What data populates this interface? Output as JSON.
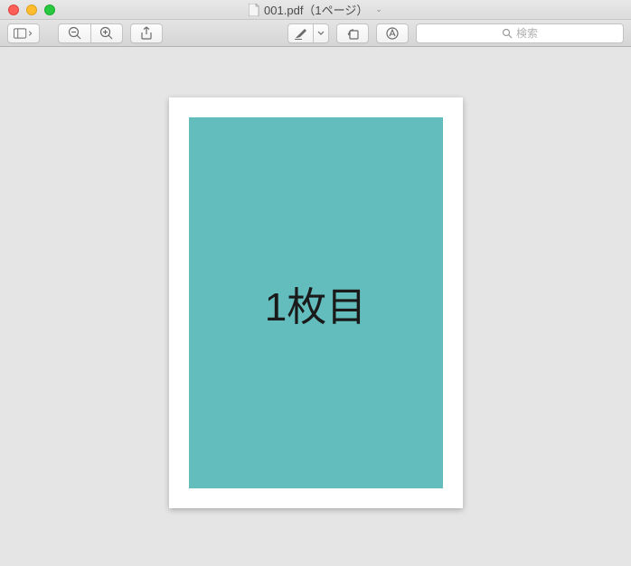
{
  "window": {
    "title": "001.pdf（1ページ）"
  },
  "toolbar": {
    "sidebar_icon": "sidebar",
    "zoom_out_icon": "zoom-out",
    "zoom_in_icon": "zoom-in",
    "share_icon": "share",
    "highlight_icon": "highlight",
    "rotate_icon": "rotate",
    "markup_icon": "markup",
    "search_placeholder": "検索"
  },
  "document": {
    "page_content": "1枚目",
    "page_bg_color": "#63bdbc"
  }
}
